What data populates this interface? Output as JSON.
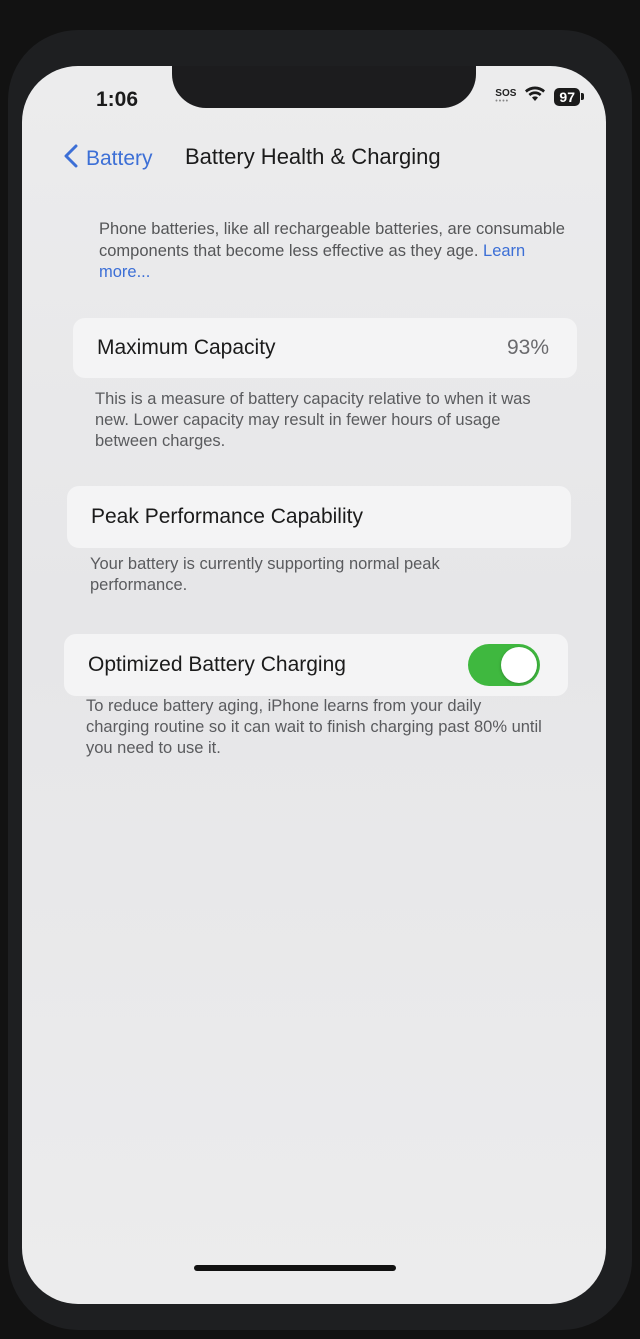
{
  "status_bar": {
    "time": "1:06",
    "sos": "SOS",
    "battery_level": "97",
    "wifi_icon": "wifi-icon"
  },
  "nav": {
    "back_label": "Battery",
    "title": "Battery Health & Charging"
  },
  "intro": {
    "text": "Phone batteries, like all rechargeable batteries, are consumable components that become less effective as they age.",
    "link_text": "Learn more..."
  },
  "max_capacity": {
    "label": "Maximum Capacity",
    "value": "93%",
    "footnote": "This is a measure of battery capacity relative to when it was new. Lower capacity may result in fewer hours of usage between charges."
  },
  "peak_performance": {
    "label": "Peak Performance Capability",
    "footnote": "Your battery is currently supporting normal peak performance."
  },
  "optimized_charging": {
    "label": "Optimized Battery Charging",
    "enabled": true,
    "footnote": "To reduce battery aging, iPhone learns from your daily charging routine so it can wait to finish charging past 80% until you need to use it."
  },
  "colors": {
    "accent": "#3c6fd6",
    "toggle_on": "#3fb83f",
    "background": "#ececed",
    "card": "#f4f4f5"
  }
}
